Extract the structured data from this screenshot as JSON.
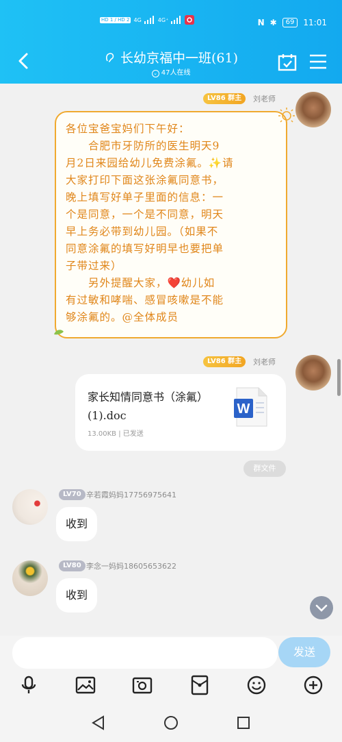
{
  "status": {
    "signal_left": "HD 1 / HD 2",
    "net1": "4G",
    "net2": "4G⁺",
    "battery": "69",
    "time": "11:01"
  },
  "header": {
    "title": "长幼京福中一班(61)",
    "online": "47人在线"
  },
  "messages": {
    "owner_tag": "LV86 群主",
    "teacher_name": "刘老师",
    "notice_lines": [
      "各位宝爸宝妈们下午好：",
      "　　合肥市牙防所的医生明天9",
      "月2日来园给幼儿免费涂氟。✨请",
      "大家打印下面这张涂氟同意书，",
      "晚上填写好单子里面的信息：一",
      "个是同意，一个是不同意，明天",
      "早上务必带到幼儿园。（如果不",
      "同意涂氟的填写好明早也要把单",
      "子带过来）",
      "　　另外提醒大家，❤️幼儿如",
      "有过敏和哮喘、感冒咳嗽是不能",
      "够涂氟的。@全体成员"
    ],
    "file": {
      "name": "家长知情同意书（涂氟）(1).doc",
      "meta": "13.00KB | 已发送",
      "group_file_label": "群文件"
    },
    "reply1": {
      "tag": "LV70",
      "name": "辛若霞妈妈17756975641",
      "text": "收到"
    },
    "reply2": {
      "tag": "LV80",
      "name": "李念一妈妈18605653622",
      "text": "收到"
    }
  },
  "input": {
    "placeholder": "",
    "send_label": "发送"
  },
  "toolbar_icons": [
    "microphone-icon",
    "image-icon",
    "camera-icon",
    "red-packet-icon",
    "emoji-icon",
    "plus-icon"
  ],
  "navbar_icons": [
    "back-triangle-icon",
    "home-circle-icon",
    "recents-square-icon"
  ],
  "colors": {
    "header": "#13a9ef",
    "notice_text": "#e0861a",
    "send": "#a6d6f6"
  }
}
